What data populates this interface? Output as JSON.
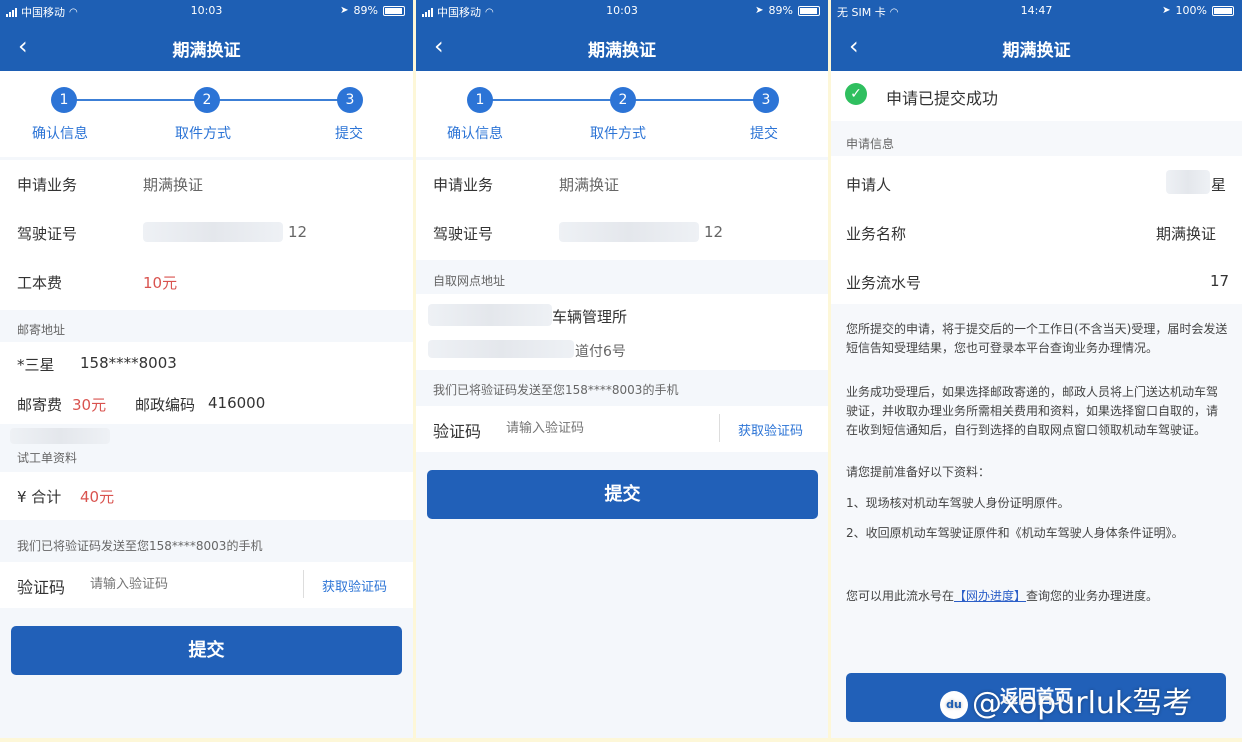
{
  "nav_title": "期满换证",
  "back_glyph": "‹",
  "steps": [
    {
      "num": "1",
      "label": "确认信息"
    },
    {
      "num": "2",
      "label": "取件方式"
    },
    {
      "num": "3",
      "label": "提交"
    }
  ],
  "screen1": {
    "status": {
      "carrier": "中国移动",
      "time": "10:03",
      "battery": "89%"
    },
    "service_label": "申请业务",
    "service_value": "期满换证",
    "license_label": "驾驶证号",
    "license_value": "12",
    "fee_label": "工本费",
    "fee_value": "10元",
    "mail_section": "邮寄地址",
    "recipient": "*三星",
    "phone": "158****8003",
    "postage_label": "邮寄费",
    "postage_value": "30元",
    "postcode_label": "邮政编码",
    "postcode_value": "416000",
    "material_section": "试工单资料",
    "total_label": "¥ 合计",
    "total_value": "40元",
    "sms_notice": "我们已将验证码发送至您158****8003的手机",
    "code_label": "验证码",
    "code_placeholder": "请输入验证码",
    "get_code": "获取验证码",
    "submit": "提交"
  },
  "screen2": {
    "status": {
      "carrier": "中国移动",
      "time": "10:03",
      "battery": "89%"
    },
    "service_label": "申请业务",
    "service_value": "期满换证",
    "license_label": "驾驶证号",
    "license_value": "12",
    "pickup_section": "自取网点地址",
    "office_name": "车辆管理所",
    "office_address": "道付6号",
    "sms_notice": "我们已将验证码发送至您158****8003的手机",
    "code_label": "验证码",
    "code_placeholder": "请输入验证码",
    "get_code": "获取验证码",
    "submit": "提交"
  },
  "screen3": {
    "status": {
      "carrier": "无 SIM 卡",
      "time": "14:47",
      "battery": "100%"
    },
    "success_text": "申请已提交成功",
    "info_section": "申请信息",
    "applicant_label": "申请人",
    "applicant_value": "星",
    "biz_name_label": "业务名称",
    "biz_name_value": "期满换证",
    "serial_label": "业务流水号",
    "serial_value": "17",
    "para1": "您所提交的申请，将于提交后的一个工作日(不含当天)受理，届时会发送短信告知受理结果，您也可登录本平台查询业务办理情况。",
    "para2": "业务成功受理后，如果选择邮政寄递的，邮政人员将上门送达机动车驾驶证，并收取办理业务所需相关费用和资料，如果选择窗口自取的，请在收到短信通知后，自行到选择的自取网点窗口领取机动车驾驶证。",
    "para3": "请您提前准备好以下资料：",
    "para4": "1、现场核对机动车驾驶人身份证明原件。",
    "para5": "2、收回原机动车驾驶证原件和《机动车驾驶人身体条件证明》。",
    "para6_pre": "您可以用此流水号在",
    "para6_link": "【网办进度】",
    "para6_post": "查询您的业务办理进度。",
    "button": "返回首页"
  },
  "watermark": {
    "logo": "du",
    "text": "@xopurluk驾考"
  },
  "colors": {
    "brand_blue": "#1e5fb4",
    "step_blue": "#2c74d6",
    "price_red": "#d9534f",
    "success_green": "#2fbf5f"
  }
}
